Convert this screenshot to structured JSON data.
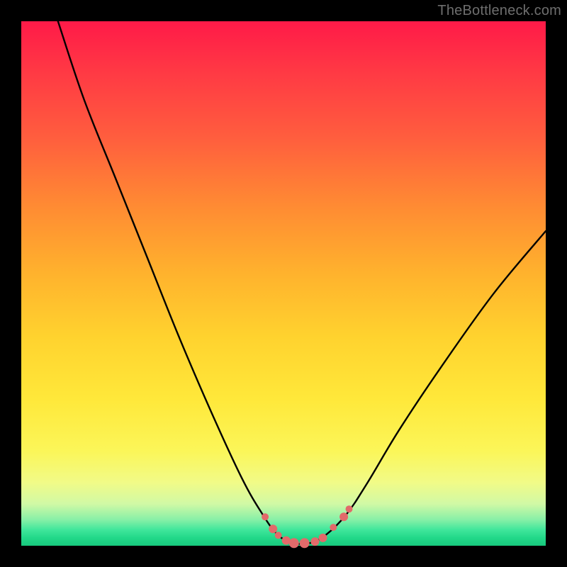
{
  "watermark": "TheBottleneck.com",
  "chart_data": {
    "type": "line",
    "title": "",
    "xlabel": "",
    "ylabel": "",
    "xlim": [
      0,
      100
    ],
    "ylim": [
      0,
      100
    ],
    "series": [
      {
        "name": "bottleneck-curve",
        "x": [
          7,
          12,
          18,
          24,
          30,
          36,
          42,
          46,
          49,
          52,
          55,
          58,
          62,
          66,
          72,
          80,
          90,
          100
        ],
        "y": [
          100,
          85,
          70,
          55,
          40,
          26,
          13,
          6,
          2,
          0.5,
          0.5,
          2,
          6,
          12,
          22,
          34,
          48,
          60
        ]
      }
    ],
    "markers": {
      "name": "highlight-points",
      "color": "#e26a6a",
      "points": [
        {
          "x": 46.5,
          "y": 5.5,
          "r": 5
        },
        {
          "x": 48.0,
          "y": 3.2,
          "r": 6
        },
        {
          "x": 49.0,
          "y": 2.0,
          "r": 5
        },
        {
          "x": 50.5,
          "y": 1.0,
          "r": 6
        },
        {
          "x": 52.0,
          "y": 0.5,
          "r": 7
        },
        {
          "x": 54.0,
          "y": 0.5,
          "r": 7
        },
        {
          "x": 56.0,
          "y": 0.8,
          "r": 6
        },
        {
          "x": 57.5,
          "y": 1.5,
          "r": 6
        },
        {
          "x": 59.5,
          "y": 3.5,
          "r": 5
        },
        {
          "x": 61.5,
          "y": 5.5,
          "r": 6
        },
        {
          "x": 62.5,
          "y": 7.0,
          "r": 5
        }
      ]
    },
    "gradient_stops": [
      {
        "pos": 0,
        "color": "#ff1a48"
      },
      {
        "pos": 35,
        "color": "#ff8a33"
      },
      {
        "pos": 72,
        "color": "#ffe83a"
      },
      {
        "pos": 95,
        "color": "#88f0a7"
      },
      {
        "pos": 100,
        "color": "#18c97d"
      }
    ]
  }
}
